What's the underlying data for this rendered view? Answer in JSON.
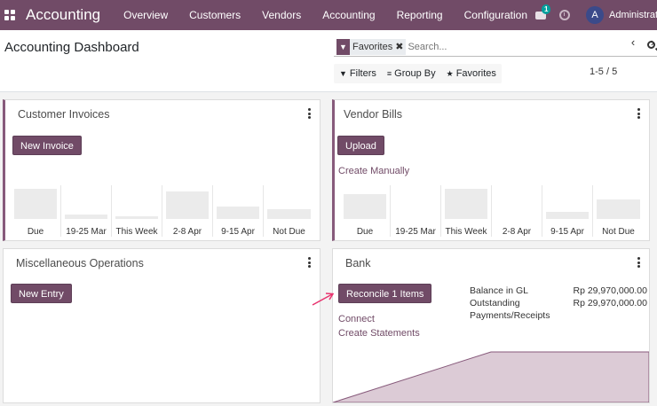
{
  "navbar": {
    "brand": "Accounting",
    "menu": [
      "Overview",
      "Customers",
      "Vendors",
      "Accounting",
      "Reporting",
      "Configuration"
    ],
    "chat_badge": "1",
    "avatar_letter": "A",
    "username": "Administrator",
    "accent_color": "#714b67"
  },
  "control_panel": {
    "title": "Accounting Dashboard",
    "search": {
      "facet_label": "Favorites",
      "placeholder": "Search..."
    },
    "filters_label": "Filters",
    "group_by_label": "Group By",
    "favorites_label": "Favorites",
    "pager": "1-5 / 5"
  },
  "cards": {
    "customer_invoices": {
      "title": "Customer Invoices",
      "button": "New Invoice",
      "graph": [
        {
          "label": "Due",
          "level": 0.6
        },
        {
          "label": "19-25 Mar",
          "level": 0.08
        },
        {
          "label": "This Week",
          "level": 0.05
        },
        {
          "label": "2-8 Apr",
          "level": 0.55
        },
        {
          "label": "9-15 Apr",
          "level": 0.25
        },
        {
          "label": "Not Due",
          "level": 0.2
        }
      ]
    },
    "vendor_bills": {
      "title": "Vendor Bills",
      "button": "Upload",
      "link": "Create Manually",
      "graph": [
        {
          "label": "Due",
          "level": 0.5
        },
        {
          "label": "19-25 Mar",
          "level": 0.0
        },
        {
          "label": "This Week",
          "level": 0.6
        },
        {
          "label": "2-8 Apr",
          "level": 0.0
        },
        {
          "label": "9-15 Apr",
          "level": 0.15
        },
        {
          "label": "Not Due",
          "level": 0.38
        }
      ]
    },
    "misc_operations": {
      "title": "Miscellaneous Operations",
      "button": "New Entry"
    },
    "bank": {
      "title": "Bank",
      "button": "Reconcile 1 Items",
      "link_connect": "Connect",
      "link_statements": "Create Statements",
      "balance_label": "Balance in GL",
      "balance_value": "Rp 29,970,000.00",
      "outstanding_label": "Outstanding Payments/Receipts",
      "outstanding_value": "Rp 29,970,000.00",
      "area_fill": "#dccbd6",
      "area_stroke": "#875a7b"
    }
  },
  "annotation_arrow_color": "#e8336e"
}
